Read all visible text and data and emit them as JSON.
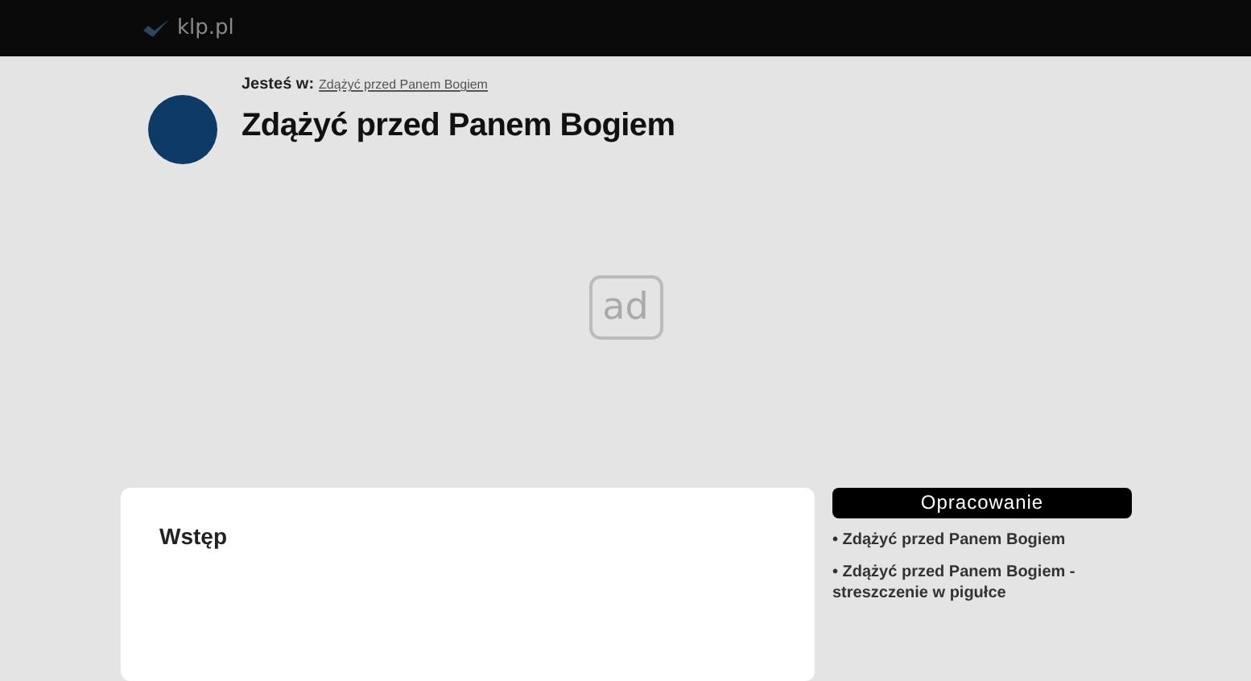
{
  "topbar": {
    "logo": "klp.pl"
  },
  "breadcrumb": {
    "label": "Jesteś w:",
    "link": "Zdążyć przed Panem Bogiem"
  },
  "title": "Zdążyć przed Panem Bogiem",
  "ad": {
    "label": "ad"
  },
  "article": {
    "heading": "Wstęp"
  },
  "sidebar": {
    "heading": "Opracowanie",
    "links": [
      "• Zdążyć przed Panem Bogiem",
      "• Zdążyć przed Panem Bogiem - streszczenie w pigułce"
    ]
  }
}
